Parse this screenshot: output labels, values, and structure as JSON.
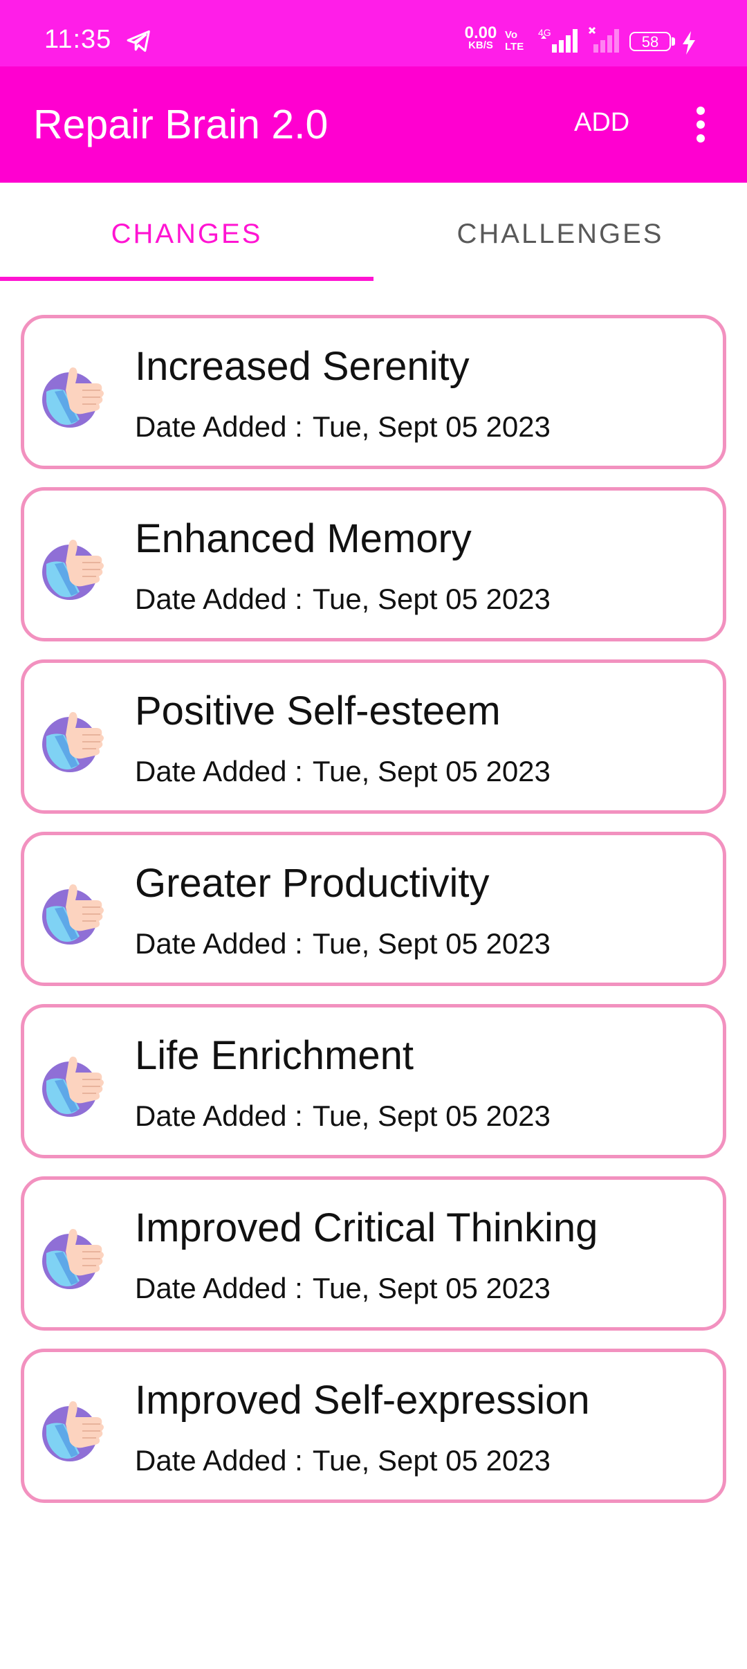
{
  "status_bar": {
    "time": "11:35",
    "net_speed_value": "0.00",
    "net_speed_unit": "KB/S",
    "volte_top": "Vo",
    "volte_bottom": "LTE",
    "network_type": "4G",
    "battery_level": "58",
    "icons": [
      "telegram-icon",
      "signal-icon",
      "no-signal-icon",
      "battery-icon",
      "charging-icon"
    ]
  },
  "app_bar": {
    "title": "Repair Brain 2.0",
    "add_label": "ADD",
    "menu_icon": "overflow-menu-icon"
  },
  "tabs": [
    {
      "label": "CHANGES",
      "selected": true
    },
    {
      "label": "CHALLENGES",
      "selected": false
    }
  ],
  "colors": {
    "status_bar": "#ff1ee8",
    "app_bar": "#ff00d0",
    "accent": "#ff14d2",
    "card_border": "#f291bf"
  },
  "changes": {
    "date_label": "Date Added :",
    "items": [
      {
        "title": "Increased Serenity",
        "date": "Tue, Sept 05 2023"
      },
      {
        "title": "Enhanced Memory",
        "date": "Tue, Sept 05 2023"
      },
      {
        "title": "Positive Self-esteem",
        "date": "Tue, Sept 05 2023"
      },
      {
        "title": "Greater Productivity",
        "date": "Tue, Sept 05 2023"
      },
      {
        "title": "Life Enrichment",
        "date": "Tue, Sept 05 2023"
      },
      {
        "title": "Improved Critical Thinking",
        "date": "Tue, Sept 05 2023"
      },
      {
        "title": "Improved Self-expression",
        "date": "Tue, Sept 05 2023"
      }
    ]
  }
}
